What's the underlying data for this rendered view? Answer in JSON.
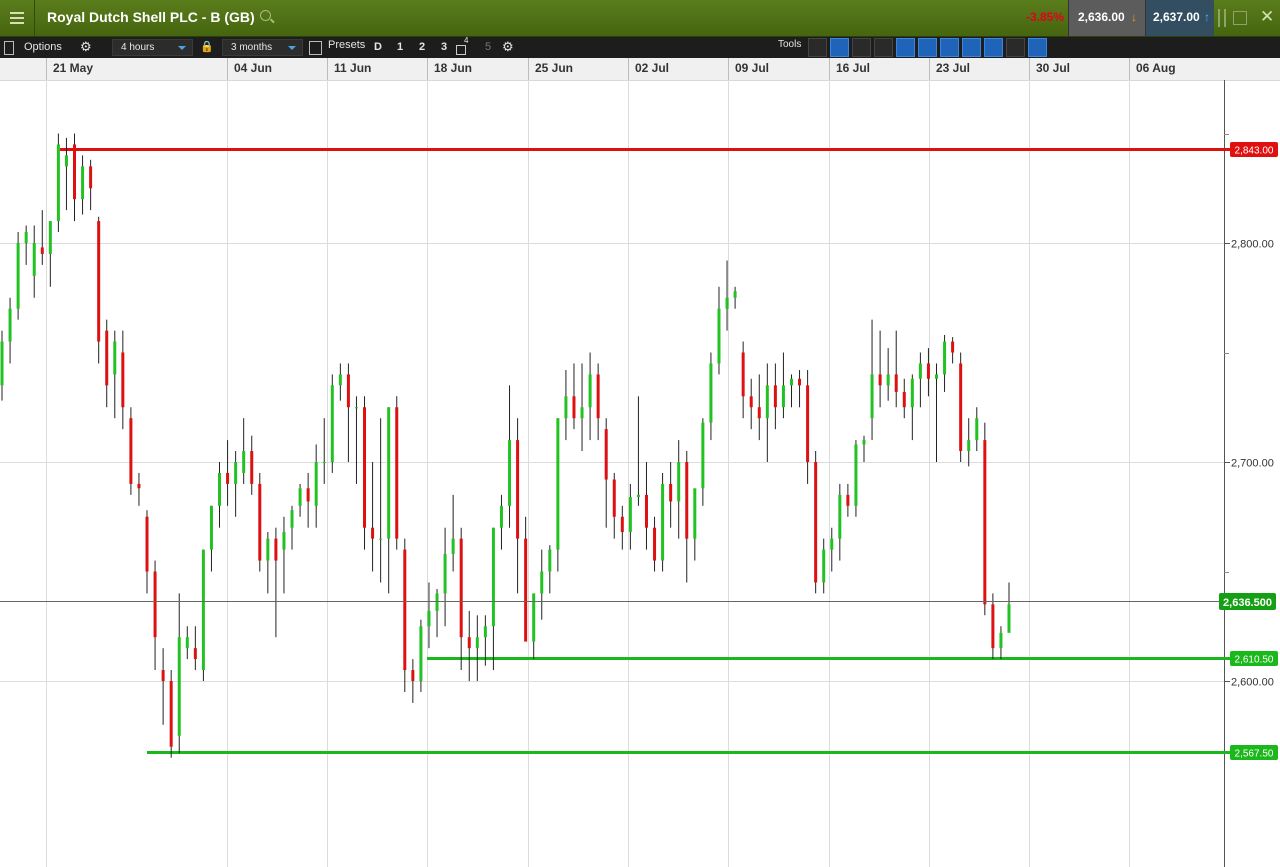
{
  "header": {
    "title": "Royal Dutch Shell PLC - B (GB)",
    "change_pct": "-3.85%",
    "sell_price": "2,636.00",
    "buy_price": "2,637.00"
  },
  "toolbar": {
    "options_label": "Options",
    "interval": "4 hours",
    "range": "3 months",
    "presets_label": "Presets",
    "preset_buttons": [
      "D",
      "1",
      "2",
      "3",
      "4",
      "5"
    ],
    "tools_label": "Tools"
  },
  "colors": {
    "up": "#22c222",
    "down": "#dd1111",
    "title_bar": "#4f7216",
    "resistance": "#e01010",
    "support": "#1bb81b"
  },
  "chart_data": {
    "type": "candlestick",
    "x_ticks": [
      "21 May",
      "04 Jun",
      "11 Jun",
      "18 Jun",
      "25 Jun",
      "02 Jul",
      "09 Jul",
      "16 Jul",
      "23 Jul",
      "30 Jul",
      "06 Aug"
    ],
    "y_ticks": [
      "2,600.00",
      "2,700.00",
      "2,800.00"
    ],
    "ylim": [
      2510,
      2880
    ],
    "candles_ohlc": [
      [
        2735,
        2760,
        2728,
        2755
      ],
      [
        2755,
        2775,
        2745,
        2770
      ],
      [
        2770,
        2805,
        2765,
        2800
      ],
      [
        2800,
        2808,
        2790,
        2805
      ],
      [
        2785,
        2808,
        2775,
        2800
      ],
      [
        2798,
        2815,
        2790,
        2795
      ],
      [
        2795,
        2810,
        2780,
        2810
      ],
      [
        2810,
        2850,
        2805,
        2845
      ],
      [
        2835,
        2848,
        2815,
        2840
      ],
      [
        2845,
        2850,
        2810,
        2820
      ],
      [
        2820,
        2840,
        2813,
        2835
      ],
      [
        2835,
        2838,
        2815,
        2825
      ],
      [
        2810,
        2812,
        2745,
        2755
      ],
      [
        2760,
        2765,
        2725,
        2735
      ],
      [
        2740,
        2760,
        2720,
        2755
      ],
      [
        2750,
        2760,
        2715,
        2725
      ],
      [
        2720,
        2725,
        2685,
        2690
      ],
      [
        2690,
        2695,
        2680,
        2688
      ],
      [
        2675,
        2678,
        2640,
        2650
      ],
      [
        2650,
        2655,
        2605,
        2620
      ],
      [
        2605,
        2615,
        2580,
        2600
      ],
      [
        2600,
        2605,
        2565,
        2570
      ],
      [
        2575,
        2640,
        2567,
        2620
      ],
      [
        2615,
        2625,
        2610,
        2620
      ],
      [
        2615,
        2625,
        2605,
        2610
      ],
      [
        2605,
        2660,
        2600,
        2660
      ],
      [
        2660,
        2680,
        2650,
        2680
      ],
      [
        2680,
        2700,
        2670,
        2695
      ],
      [
        2695,
        2710,
        2680,
        2690
      ],
      [
        2690,
        2705,
        2675,
        2700
      ],
      [
        2695,
        2720,
        2690,
        2705
      ],
      [
        2705,
        2712,
        2685,
        2690
      ],
      [
        2690,
        2695,
        2650,
        2655
      ],
      [
        2655,
        2668,
        2640,
        2665
      ],
      [
        2665,
        2670,
        2620,
        2655
      ],
      [
        2660,
        2675,
        2640,
        2668
      ],
      [
        2670,
        2680,
        2660,
        2678
      ],
      [
        2680,
        2690,
        2675,
        2688
      ],
      [
        2688,
        2695,
        2670,
        2682
      ],
      [
        2680,
        2708,
        2670,
        2700
      ],
      [
        2700,
        2720,
        2690,
        2700
      ],
      [
        2700,
        2740,
        2695,
        2735
      ],
      [
        2735,
        2745,
        2728,
        2740
      ],
      [
        2740,
        2745,
        2700,
        2725
      ],
      [
        2725,
        2730,
        2690,
        2725
      ],
      [
        2725,
        2730,
        2660,
        2670
      ],
      [
        2670,
        2700,
        2650,
        2665
      ],
      [
        2665,
        2720,
        2645,
        2665
      ],
      [
        2665,
        2725,
        2640,
        2725
      ],
      [
        2725,
        2730,
        2660,
        2665
      ],
      [
        2660,
        2665,
        2595,
        2605
      ],
      [
        2605,
        2610,
        2590,
        2600
      ],
      [
        2600,
        2628,
        2595,
        2625
      ],
      [
        2625,
        2645,
        2615,
        2632
      ],
      [
        2632,
        2642,
        2620,
        2640
      ],
      [
        2640,
        2670,
        2625,
        2658
      ],
      [
        2658,
        2685,
        2650,
        2665
      ],
      [
        2665,
        2670,
        2605,
        2620
      ],
      [
        2620,
        2632,
        2600,
        2615
      ],
      [
        2615,
        2630,
        2600,
        2620
      ],
      [
        2620,
        2630,
        2607,
        2625
      ],
      [
        2625,
        2670,
        2605,
        2670
      ],
      [
        2670,
        2685,
        2660,
        2680
      ],
      [
        2680,
        2735,
        2670,
        2710
      ],
      [
        2710,
        2720,
        2640,
        2665
      ],
      [
        2665,
        2675,
        2620,
        2618
      ],
      [
        2618,
        2625,
        2610,
        2640
      ],
      [
        2640,
        2660,
        2628,
        2650
      ],
      [
        2650,
        2662,
        2640,
        2660
      ],
      [
        2660,
        2720,
        2650,
        2720
      ],
      [
        2720,
        2742,
        2710,
        2730
      ],
      [
        2730,
        2745,
        2715,
        2720
      ],
      [
        2720,
        2745,
        2705,
        2725
      ],
      [
        2725,
        2750,
        2710,
        2740
      ],
      [
        2740,
        2745,
        2710,
        2720
      ],
      [
        2715,
        2720,
        2670,
        2692
      ],
      [
        2692,
        2695,
        2665,
        2675
      ],
      [
        2675,
        2680,
        2660,
        2668
      ],
      [
        2668,
        2690,
        2660,
        2684
      ],
      [
        2684,
        2730,
        2680,
        2685
      ],
      [
        2685,
        2700,
        2660,
        2670
      ],
      [
        2670,
        2675,
        2650,
        2655
      ],
      [
        2655,
        2695,
        2650,
        2690
      ],
      [
        2690,
        2700,
        2670,
        2682
      ],
      [
        2682,
        2710,
        2665,
        2700
      ],
      [
        2700,
        2705,
        2645,
        2665
      ],
      [
        2665,
        2680,
        2655,
        2688
      ],
      [
        2688,
        2720,
        2680,
        2718
      ],
      [
        2718,
        2750,
        2710,
        2745
      ],
      [
        2745,
        2780,
        2740,
        2770
      ],
      [
        2770,
        2792,
        2760,
        2775
      ],
      [
        2775,
        2780,
        2770,
        2778
      ],
      [
        2750,
        2755,
        2720,
        2730
      ],
      [
        2730,
        2738,
        2715,
        2725
      ],
      [
        2725,
        2740,
        2710,
        2720
      ],
      [
        2720,
        2745,
        2700,
        2735
      ],
      [
        2735,
        2745,
        2715,
        2725
      ],
      [
        2725,
        2750,
        2720,
        2735
      ],
      [
        2735,
        2740,
        2725,
        2738
      ],
      [
        2738,
        2742,
        2725,
        2735
      ],
      [
        2735,
        2742,
        2690,
        2700
      ],
      [
        2700,
        2705,
        2640,
        2645
      ],
      [
        2645,
        2665,
        2640,
        2660
      ],
      [
        2660,
        2670,
        2650,
        2665
      ],
      [
        2665,
        2690,
        2655,
        2685
      ],
      [
        2685,
        2690,
        2675,
        2680
      ],
      [
        2680,
        2710,
        2675,
        2708
      ],
      [
        2708,
        2712,
        2700,
        2710
      ],
      [
        2720,
        2765,
        2710,
        2740
      ],
      [
        2740,
        2760,
        2725,
        2735
      ],
      [
        2735,
        2752,
        2728,
        2740
      ],
      [
        2740,
        2760,
        2725,
        2732
      ],
      [
        2732,
        2738,
        2720,
        2725
      ],
      [
        2725,
        2740,
        2710,
        2738
      ],
      [
        2738,
        2750,
        2725,
        2745
      ],
      [
        2745,
        2752,
        2730,
        2738
      ],
      [
        2738,
        2745,
        2700,
        2740
      ],
      [
        2740,
        2758,
        2732,
        2755
      ],
      [
        2755,
        2757,
        2745,
        2750
      ],
      [
        2745,
        2750,
        2700,
        2705
      ],
      [
        2705,
        2720,
        2698,
        2710
      ],
      [
        2710,
        2725,
        2705,
        2720
      ],
      [
        2710,
        2718,
        2630,
        2635
      ],
      [
        2635,
        2640,
        2610,
        2615
      ],
      [
        2615,
        2625,
        2610,
        2622
      ],
      [
        2622,
        2645,
        2625,
        2635
      ]
    ],
    "hlines": [
      {
        "label": "2,843.00",
        "value": 2843.0,
        "kind": "resistance"
      },
      {
        "label": "2,610.50",
        "value": 2610.5,
        "kind": "support"
      },
      {
        "label": "2,567.50",
        "value": 2567.5,
        "kind": "support"
      }
    ],
    "current_price": {
      "label": "2,636.500",
      "value": 2636.5
    }
  }
}
